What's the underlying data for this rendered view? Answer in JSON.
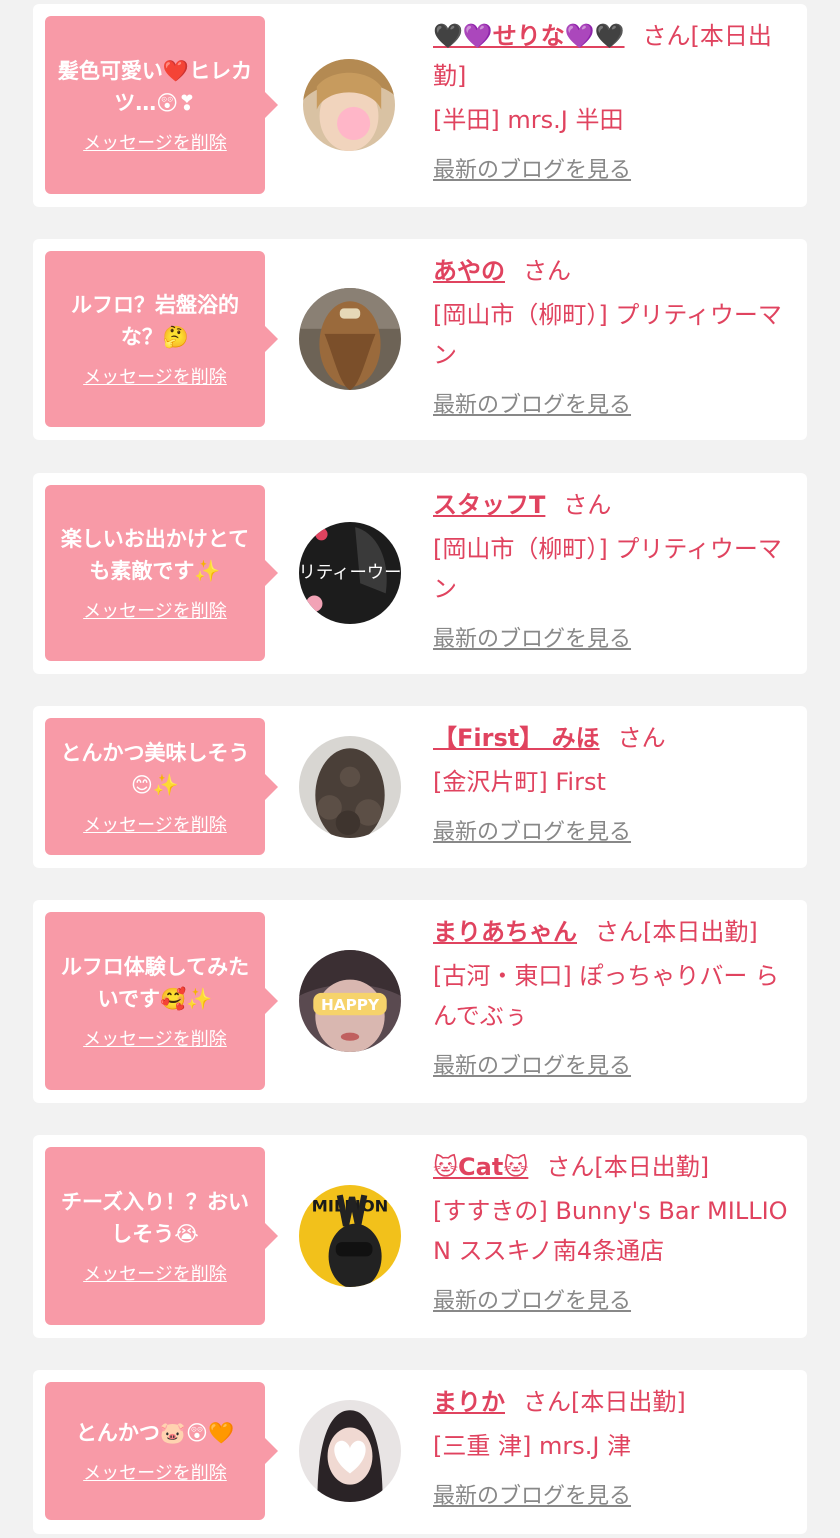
{
  "colors": {
    "accent": "#e0435f",
    "bubble": "#f89aa7",
    "muted": "#888888",
    "background": "#f2f2f2",
    "card": "#ffffff"
  },
  "items": [
    {
      "message": "髪色可愛い❤️ヒレカツ…😲❣",
      "delete_label": "メッセージを削除",
      "name": "🖤💜せりな💜🖤",
      "suffix": "さん[本日出勤]",
      "shop": "[半田] mrs.J 半田",
      "blog_label": "最新のブログを見る",
      "avatar_icon": "avatar-blonde-hair"
    },
    {
      "message": "ルフロ？岩盤浴的な？🤔",
      "delete_label": "メッセージを削除",
      "name": "あやの",
      "suffix": "さん",
      "shop": "[岡山市（柳町）] プリティウーマン",
      "blog_label": "最新のブログを見る",
      "avatar_icon": "avatar-back-of-head"
    },
    {
      "message": "楽しいお出かけとても素敵です✨",
      "delete_label": "メッセージを削除",
      "name": "スタッフT",
      "suffix": "さん",
      "shop": "[岡山市（柳町）] プリティウーマン",
      "blog_label": "最新のブログを見る",
      "avatar_icon": "avatar-shop-logo",
      "avatar_text": "プリティーウーマ"
    },
    {
      "message": "とんかつ美味しそう😊✨",
      "delete_label": "メッセージを削除",
      "name": "【First】 みほ",
      "suffix": "さん",
      "shop": "[金沢片町] First",
      "blog_label": "最新のブログを見る",
      "avatar_icon": "avatar-curly-hair"
    },
    {
      "message": "ルフロ体験してみたいです🥰✨",
      "delete_label": "メッセージを削除",
      "name": "まりあちゃん",
      "suffix": "さん[本日出勤]",
      "shop": "[古河・東口] ぽっちゃりバー らんでぶぅ",
      "blog_label": "最新のブログを見る",
      "avatar_icon": "avatar-happy-sticker",
      "avatar_text": "HAPPY"
    },
    {
      "message": "チーズ入り！？おいしそう😭",
      "delete_label": "メッセージを削除",
      "name": "🐱Cat🐱",
      "suffix": "さん[本日出勤]",
      "shop": "[すすきの] Bunny's Bar MILLION ススキノ南4条通店",
      "blog_label": "最新のブログを見る",
      "avatar_icon": "avatar-magazine-cover",
      "avatar_text": "MILLION"
    },
    {
      "message": "とんかつ🐷😲🧡",
      "delete_label": "メッセージを削除",
      "name": "まりか",
      "suffix": "さん[本日出勤]",
      "shop": "[三重 津] mrs.J 津",
      "blog_label": "最新のブログを見る",
      "avatar_icon": "avatar-heart-face"
    }
  ]
}
